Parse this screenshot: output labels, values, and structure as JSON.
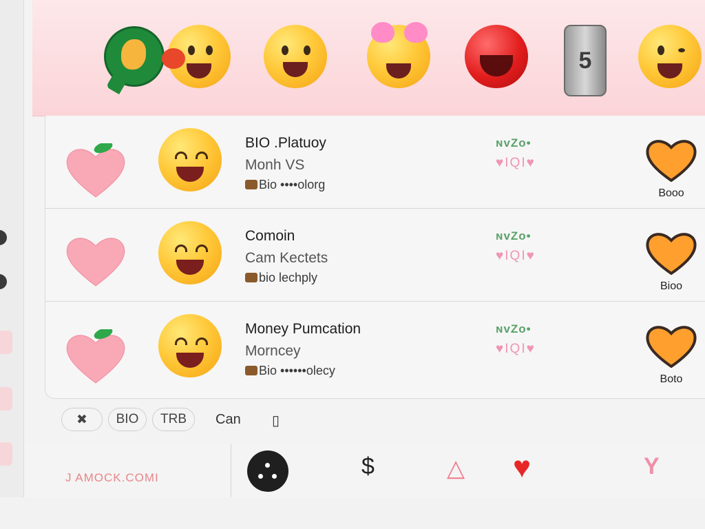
{
  "emoji_bar": {
    "items": [
      "chat-bubble-emoji",
      "wink-emoji",
      "laughing-emoji",
      "heart-eyes-emoji",
      "red-face-emoji",
      "bolt-icon",
      "winking-smile-emoji"
    ],
    "tool_glyph": "5"
  },
  "rows": [
    {
      "title": "BIO .Platuoy",
      "subtitle": "Monh VS",
      "meta": "Bio ••••olorg",
      "stats": "ɴvZo•",
      "reactions": "♥IQI♥",
      "badge": "Booo",
      "heart_leaf": true
    },
    {
      "title": "Comoin",
      "subtitle": "Cam Kectets",
      "meta": "bio lechply",
      "stats": "ɴvZo•",
      "reactions": "♥IQI♥",
      "badge": "Bioo",
      "heart_leaf": false
    },
    {
      "title": "Money Pumcation",
      "subtitle": "Morncey",
      "meta": "Bio ••••••olecy",
      "stats": "ɴvZo•",
      "reactions": "♥IQI♥",
      "badge": "Boto",
      "heart_leaf": true
    }
  ],
  "chips": {
    "chip1": "✖",
    "chip2": "BIO",
    "chip3": "TRB",
    "text": "Can",
    "square": "▯"
  },
  "footer": {
    "brand": "J AMOCK.COMI",
    "nav_dollar": "$",
    "nav_triangle": "△",
    "nav_heart": "♥",
    "nav_y": "Y"
  },
  "colors": {
    "accent_pink": "#fbd4d8",
    "heart_pink": "#f9a8b6",
    "leaf_green": "#2fa84a",
    "badge_orange": "#ff9f2e"
  }
}
